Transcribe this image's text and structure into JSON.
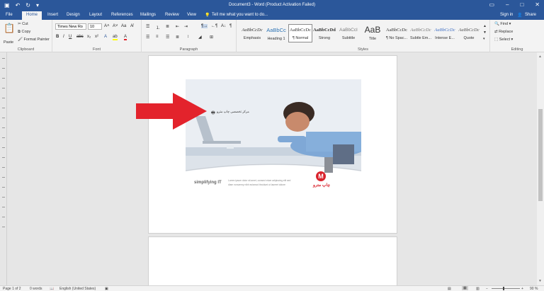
{
  "titlebar": {
    "title": "Document3 - Word (Product Activation Failed)",
    "save_icon": "save-icon",
    "undo_icon": "undo-icon",
    "redo_icon": "redo-icon"
  },
  "tabs": [
    "File",
    "Home",
    "Insert",
    "Design",
    "Layout",
    "References",
    "Mailings",
    "Review",
    "View"
  ],
  "tell_me": "Tell me what you want to do...",
  "sign_in": "Sign in",
  "share": "Share",
  "clipboard": {
    "paste": "Paste",
    "cut": "Cut",
    "copy": "Copy",
    "format_painter": "Format Painter",
    "label": "Clipboard"
  },
  "font": {
    "name": "Times New Ro",
    "size": "10",
    "label": "Font"
  },
  "paragraph": {
    "label": "Paragraph"
  },
  "styles": {
    "label": "Styles",
    "items": [
      {
        "preview": "AaBbCcDc",
        "name": "Emphasis"
      },
      {
        "preview": "AaBbCc",
        "name": "Heading 1"
      },
      {
        "preview": "AaBbCcDc",
        "name": "¶ Normal"
      },
      {
        "preview": "AaBbCcDd",
        "name": "Strong"
      },
      {
        "preview": "AaBbCcI",
        "name": "Subtitle"
      },
      {
        "preview": "AaB",
        "name": "Title"
      },
      {
        "preview": "AaBbCcDc",
        "name": "¶ No Spac..."
      },
      {
        "preview": "AaBbCcDc",
        "name": "Subtle Em..."
      },
      {
        "preview": "AaBbCcDc",
        "name": "Intense E..."
      },
      {
        "preview": "AaBbCcDc",
        "name": "Quote"
      }
    ]
  },
  "editing": {
    "find": "Find",
    "replace": "Replace",
    "select": "Select",
    "label": "Editing"
  },
  "document": {
    "tagline": "simplifying IT",
    "arabic_caption": "مرکز تخصصی چاپ مترو",
    "logo_text": "چاپ مترو",
    "lorem1": "Lorem ipsum dolor sit amet, consect etuer adipiscing elit sed",
    "lorem2": "diam nonummy nibh euismod tincidunt ut laoreet dolore"
  },
  "status": {
    "page": "Page 1 of 2",
    "words": "0 words",
    "language": "English (United States)",
    "zoom": "90 %"
  },
  "colors": {
    "accent": "#2b579a",
    "arrow": "#e3232c",
    "logo": "#d9232d"
  }
}
